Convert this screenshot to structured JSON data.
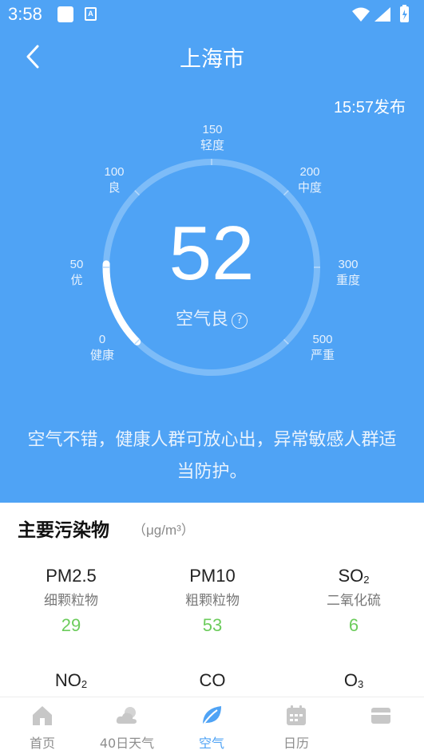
{
  "status_bar": {
    "time": "3:58",
    "icon_a_label": "A"
  },
  "header": {
    "city": "上海市",
    "publish_time": "15:57发布"
  },
  "gauge": {
    "aqi": "52",
    "aqi_value": 52,
    "level_text": "空气良",
    "help_symbol": "?",
    "ticks": [
      {
        "value": "0",
        "label": "健康"
      },
      {
        "value": "50",
        "label": "优"
      },
      {
        "value": "100",
        "label": "良"
      },
      {
        "value": "150",
        "label": "轻度"
      },
      {
        "value": "200",
        "label": "中度"
      },
      {
        "value": "300",
        "label": "重度"
      },
      {
        "value": "500",
        "label": "严重"
      }
    ]
  },
  "advice": "空气不错，健康人群可放心出，异常敏感人群适当防护。",
  "pollutants": {
    "title": "主要污染物",
    "unit": "（μg/m³）",
    "items": [
      {
        "name": "PM2.5",
        "sub": "",
        "desc": "细颗粒物",
        "value": "29"
      },
      {
        "name": "PM10",
        "sub": "",
        "desc": "粗颗粒物",
        "value": "53"
      },
      {
        "name": "SO",
        "sub": "2",
        "desc": "二氧化硫",
        "value": "6"
      },
      {
        "name": "NO",
        "sub": "2",
        "desc": "",
        "value": ""
      },
      {
        "name": "CO",
        "sub": "",
        "desc": "",
        "value": ""
      },
      {
        "name": "O",
        "sub": "3",
        "desc": "",
        "value": ""
      }
    ]
  },
  "nav": {
    "items": [
      {
        "label": "首页",
        "icon": "home-icon"
      },
      {
        "label": "40日天气",
        "icon": "cloud-icon"
      },
      {
        "label": "空气",
        "icon": "leaf-icon"
      },
      {
        "label": "日历",
        "icon": "calendar-icon"
      },
      {
        "label": "",
        "icon": "card-icon"
      }
    ],
    "active": "空气"
  },
  "colors": {
    "background_blue": "#4fa3f5",
    "gauge_track": "#7dbcf8",
    "gauge_progress": "#ffffff",
    "value_green": "#6ccc5c"
  }
}
